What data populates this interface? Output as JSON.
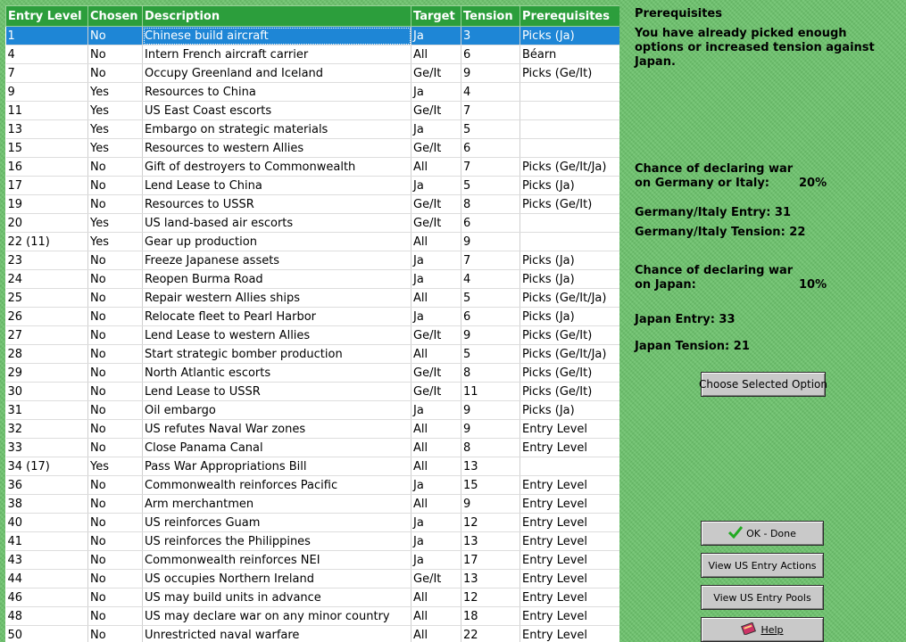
{
  "table": {
    "headers": [
      "Entry Level",
      "Chosen",
      "Description",
      "Target",
      "Tension",
      "Prerequisites"
    ],
    "selected_index": 0,
    "rows": [
      [
        "1",
        "No",
        "Chinese build aircraft",
        "Ja",
        "3",
        "Picks (Ja)"
      ],
      [
        "4",
        "No",
        "Intern French aircraft carrier",
        "All",
        "6",
        "Béarn"
      ],
      [
        "7",
        "No",
        "Occupy Greenland and Iceland",
        "Ge/It",
        "9",
        "Picks (Ge/It)"
      ],
      [
        "9",
        "Yes",
        "Resources to China",
        "Ja",
        "4",
        ""
      ],
      [
        "11",
        "Yes",
        "US East Coast escorts",
        "Ge/It",
        "7",
        ""
      ],
      [
        "13",
        "Yes",
        "Embargo on strategic materials",
        "Ja",
        "5",
        ""
      ],
      [
        "15",
        "Yes",
        "Resources to western Allies",
        "Ge/It",
        "6",
        ""
      ],
      [
        "16",
        "No",
        "Gift of destroyers to Commonwealth",
        "All",
        "7",
        "Picks (Ge/It/Ja)"
      ],
      [
        "17",
        "No",
        "Lend Lease to China",
        "Ja",
        "5",
        "Picks (Ja)"
      ],
      [
        "19",
        "No",
        "Resources to USSR",
        "Ge/It",
        "8",
        "Picks (Ge/It)"
      ],
      [
        "20",
        "Yes",
        "US land-based air escorts",
        "Ge/It",
        "6",
        ""
      ],
      [
        "22 (11)",
        "Yes",
        "Gear up production",
        "All",
        "9",
        ""
      ],
      [
        "23",
        "No",
        "Freeze Japanese assets",
        "Ja",
        "7",
        "Picks (Ja)"
      ],
      [
        "24",
        "No",
        "Reopen Burma Road",
        "Ja",
        "4",
        "Picks (Ja)"
      ],
      [
        "25",
        "No",
        "Repair western Allies ships",
        "All",
        "5",
        "Picks (Ge/It/Ja)"
      ],
      [
        "26",
        "No",
        "Relocate fleet to Pearl Harbor",
        "Ja",
        "6",
        "Picks (Ja)"
      ],
      [
        "27",
        "No",
        "Lend Lease to western Allies",
        "Ge/It",
        "9",
        "Picks (Ge/It)"
      ],
      [
        "28",
        "No",
        "Start strategic bomber production",
        "All",
        "5",
        "Picks (Ge/It/Ja)"
      ],
      [
        "29",
        "No",
        "North Atlantic escorts",
        "Ge/It",
        "8",
        "Picks (Ge/It)"
      ],
      [
        "30",
        "No",
        "Lend Lease to USSR",
        "Ge/It",
        "11",
        "Picks (Ge/It)"
      ],
      [
        "31",
        "No",
        "Oil embargo",
        "Ja",
        "9",
        "Picks (Ja)"
      ],
      [
        "32",
        "No",
        "US refutes Naval War zones",
        "All",
        "9",
        "Entry Level"
      ],
      [
        "33",
        "No",
        "Close Panama Canal",
        "All",
        "8",
        "Entry Level"
      ],
      [
        "34 (17)",
        "Yes",
        "Pass War Appropriations Bill",
        "All",
        "13",
        ""
      ],
      [
        "36",
        "No",
        "Commonwealth reinforces Pacific",
        "Ja",
        "15",
        "Entry Level"
      ],
      [
        "38",
        "No",
        "Arm merchantmen",
        "All",
        "9",
        "Entry Level"
      ],
      [
        "40",
        "No",
        "US reinforces Guam",
        "Ja",
        "12",
        "Entry Level"
      ],
      [
        "41",
        "No",
        "US reinforces the Philippines",
        "Ja",
        "13",
        "Entry Level"
      ],
      [
        "43",
        "No",
        "Commonwealth reinforces NEI",
        "Ja",
        "17",
        "Entry Level"
      ],
      [
        "44",
        "No",
        "US occupies Northern Ireland",
        "Ge/It",
        "13",
        "Entry Level"
      ],
      [
        "46",
        "No",
        "US may build units in advance",
        "All",
        "12",
        "Entry Level"
      ],
      [
        "48",
        "No",
        "US may declare war on any minor country",
        "All",
        "18",
        "Entry Level"
      ],
      [
        "50",
        "No",
        "Unrestricted naval warfare",
        "All",
        "22",
        "Entry Level"
      ]
    ]
  },
  "side": {
    "prereq_title": "Prerequisites",
    "prereq_message": "You have already picked enough options or increased tension against Japan.",
    "ge_chance": "Chance of declaring war\non Germany or Italy:",
    "ge_pct": "20%",
    "ge_entry": "Germany/Italy Entry: 31",
    "ge_tension": "Germany/Italy Tension: 22",
    "ja_chance": "Chance of declaring war\non Japan:",
    "ja_pct": "10%",
    "ja_entry": "Japan Entry: 33",
    "ja_tension": "Japan Tension: 21"
  },
  "buttons": {
    "choose": "Choose Selected Option",
    "ok": "OK - Done",
    "actions": "View US Entry Actions",
    "pools": "View US Entry Pools",
    "help": "Help"
  },
  "icons": {
    "ok": "check-icon",
    "help": "book-icon"
  },
  "colors": {
    "header_bg": "#2c9e3c",
    "selected_row": "#1e86d6",
    "background": "#6cc36c",
    "check": "#22aa22"
  }
}
